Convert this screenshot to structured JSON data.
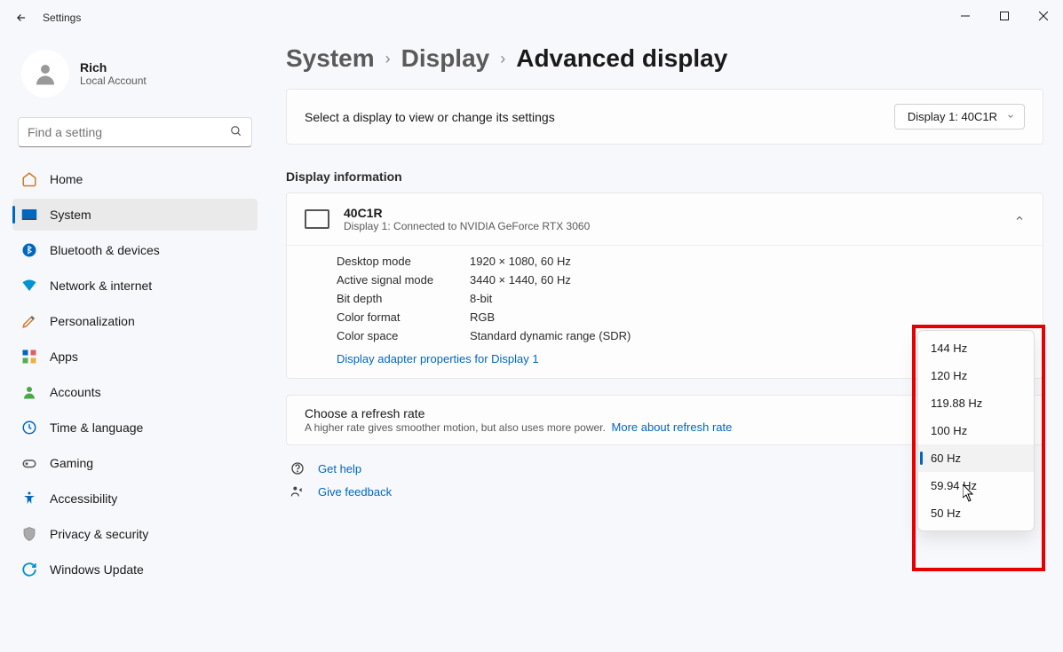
{
  "window": {
    "title": "Settings"
  },
  "profile": {
    "name": "Rich",
    "account_type": "Local Account"
  },
  "search": {
    "placeholder": "Find a setting"
  },
  "nav": [
    {
      "key": "home",
      "label": "Home"
    },
    {
      "key": "system",
      "label": "System"
    },
    {
      "key": "bluetooth",
      "label": "Bluetooth & devices"
    },
    {
      "key": "network",
      "label": "Network & internet"
    },
    {
      "key": "personalization",
      "label": "Personalization"
    },
    {
      "key": "apps",
      "label": "Apps"
    },
    {
      "key": "accounts",
      "label": "Accounts"
    },
    {
      "key": "time",
      "label": "Time & language"
    },
    {
      "key": "gaming",
      "label": "Gaming"
    },
    {
      "key": "accessibility",
      "label": "Accessibility"
    },
    {
      "key": "privacy",
      "label": "Privacy & security"
    },
    {
      "key": "update",
      "label": "Windows Update"
    }
  ],
  "breadcrumb": {
    "item1": "System",
    "item2": "Display",
    "item3": "Advanced display"
  },
  "select_display": {
    "prompt": "Select a display to view or change its settings",
    "selected": "Display 1: 40C1R"
  },
  "section_info_label": "Display information",
  "display_info": {
    "name": "40C1R",
    "subtitle": "Display 1: Connected to NVIDIA GeForce RTX 3060",
    "props": {
      "desktop_mode_k": "Desktop mode",
      "desktop_mode_v": "1920 × 1080, 60 Hz",
      "active_signal_k": "Active signal mode",
      "active_signal_v": "3440 × 1440, 60 Hz",
      "bit_depth_k": "Bit depth",
      "bit_depth_v": "8-bit",
      "color_format_k": "Color format",
      "color_format_v": "RGB",
      "color_space_k": "Color space",
      "color_space_v": "Standard dynamic range (SDR)"
    },
    "adapter_link": "Display adapter properties for Display 1"
  },
  "refresh": {
    "title": "Choose a refresh rate",
    "subtitle": "A higher rate gives smoother motion, but also uses more power.",
    "more_link": "More about refresh rate",
    "options": [
      "144 Hz",
      "120 Hz",
      "119.88 Hz",
      "100 Hz",
      "60 Hz",
      "59.94 Hz",
      "50 Hz"
    ],
    "selected": "60 Hz"
  },
  "help": {
    "get_help": "Get help",
    "give_feedback": "Give feedback"
  }
}
